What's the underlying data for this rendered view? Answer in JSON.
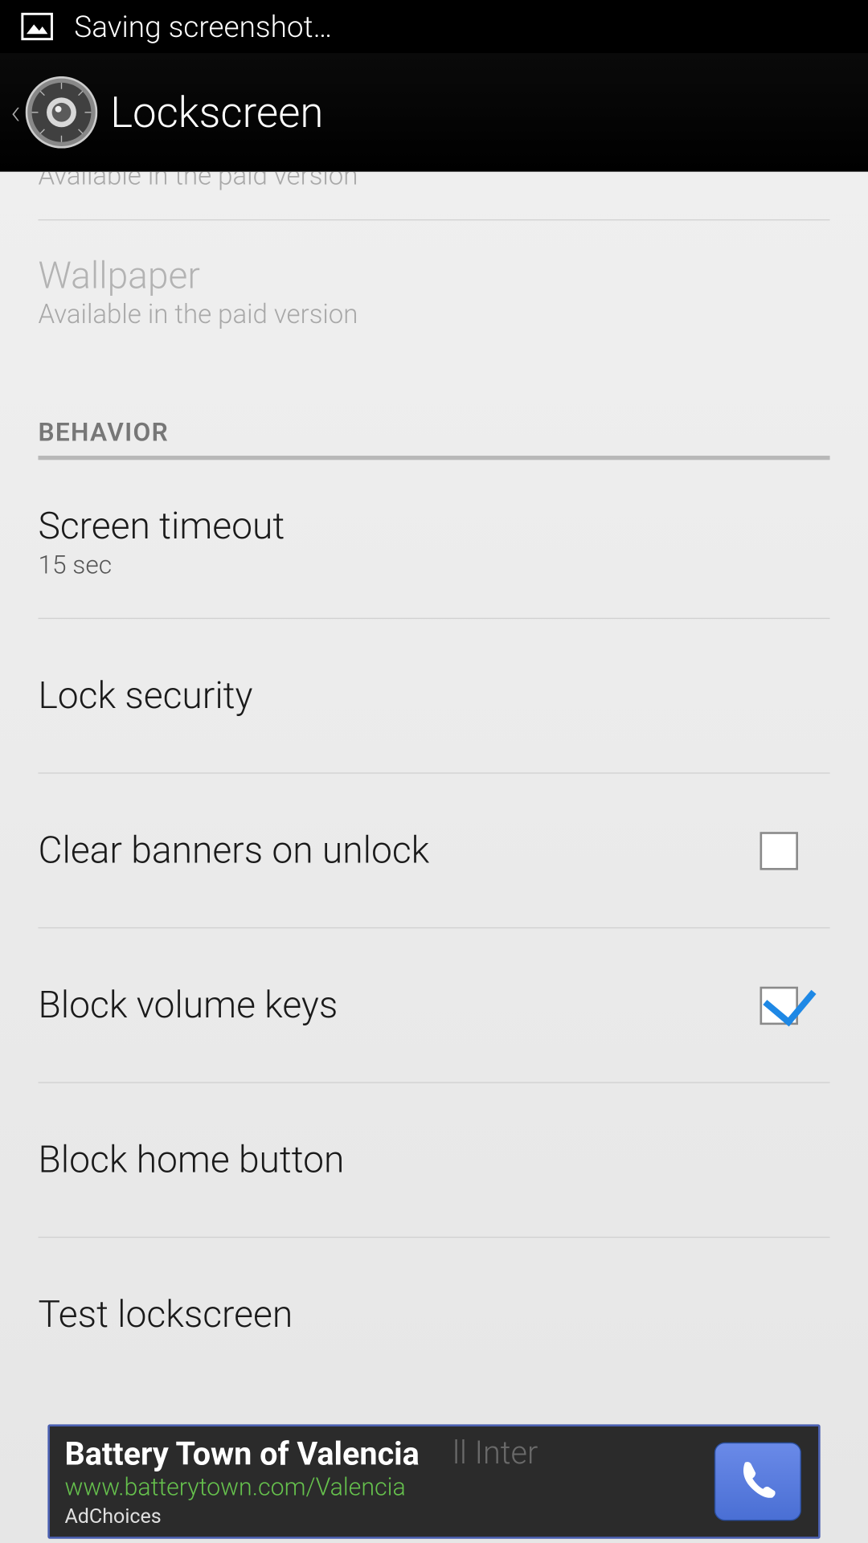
{
  "status": {
    "text": "Saving screenshot…"
  },
  "header": {
    "title": "Lockscreen"
  },
  "list": {
    "partial_item": {
      "subtitle": "Available in the paid version"
    },
    "wallpaper": {
      "title": "Wallpaper",
      "subtitle": "Available in the paid version"
    },
    "section_behavior": "BEHAVIOR",
    "screen_timeout": {
      "title": "Screen timeout",
      "subtitle": "15 sec"
    },
    "lock_security": {
      "title": "Lock security"
    },
    "clear_banners": {
      "title": "Clear banners on unlock",
      "checked": false
    },
    "block_volume": {
      "title": "Block volume keys",
      "checked": true
    },
    "block_home": {
      "title": "Block home button"
    },
    "test_lockscreen": {
      "title": "Test lockscreen"
    }
  },
  "ad": {
    "back_text": "ll Inter",
    "title": "Battery Town of Valencia",
    "url": "www.batterytown.com/Valencia",
    "adchoices": "AdChoices"
  }
}
